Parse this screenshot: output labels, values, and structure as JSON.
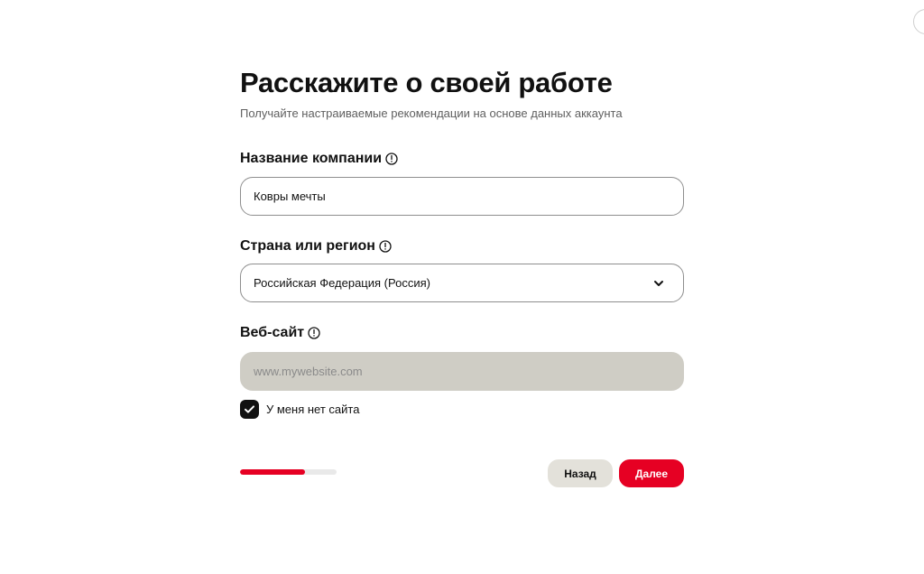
{
  "header": {
    "title": "Расскажите о своей работе",
    "subtitle": "Получайте настраиваемые рекомендации на основе данных аккаунта"
  },
  "fields": {
    "company": {
      "label": "Название компании",
      "value": "Ковры мечты",
      "icon": "info-icon"
    },
    "country": {
      "label": "Страна или регион",
      "value": "Российская Федерация (Россия)",
      "icon": "info-icon",
      "dropdown_icon": "chevron-down-icon"
    },
    "website": {
      "label": "Веб-сайт",
      "placeholder": "www.mywebsite.com",
      "value": "",
      "disabled": true,
      "icon": "info-icon"
    }
  },
  "no_website_checkbox": {
    "label": "У меня нет сайта",
    "checked": true
  },
  "progress": {
    "fraction": 0.67
  },
  "buttons": {
    "back_label": "Назад",
    "next_label": "Далее"
  },
  "colors": {
    "accent": "#e60023",
    "disabled_input": "#cfcdc5",
    "secondary_button": "#e3e1da",
    "progress_track": "#e9e9e9"
  }
}
